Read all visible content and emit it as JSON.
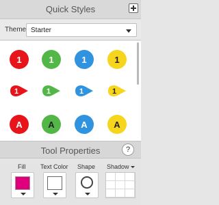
{
  "quick_styles": {
    "title": "Quick Styles",
    "add_icon": "plus-icon",
    "theme_label": "Theme:",
    "theme_value": "Starter",
    "colors": {
      "red": "#e8141c",
      "green": "#53b748",
      "blue": "#2f93e0",
      "yellow": "#f7d51d"
    },
    "rows": [
      {
        "kind": "circle-number",
        "items": [
          {
            "label": "1",
            "color": "red",
            "text_color": "#ffffff"
          },
          {
            "label": "1",
            "color": "green",
            "text_color": "#ffffff"
          },
          {
            "label": "1",
            "color": "blue",
            "text_color": "#ffffff"
          },
          {
            "label": "1",
            "color": "yellow",
            "text_color": "#222222"
          }
        ]
      },
      {
        "kind": "pointer-number",
        "items": [
          {
            "label": "1",
            "color": "red",
            "text_color": "#ffffff"
          },
          {
            "label": "1",
            "color": "green",
            "text_color": "#ffffff"
          },
          {
            "label": "1",
            "color": "blue",
            "text_color": "#ffffff"
          },
          {
            "label": "1",
            "color": "yellow",
            "text_color": "#222222"
          }
        ]
      },
      {
        "kind": "circle-letter",
        "items": [
          {
            "label": "A",
            "color": "red",
            "text_color": "#ffffff"
          },
          {
            "label": "A",
            "color": "green",
            "text_color": "#222222"
          },
          {
            "label": "A",
            "color": "blue",
            "text_color": "#ffffff"
          },
          {
            "label": "A",
            "color": "yellow",
            "text_color": "#222222"
          }
        ]
      }
    ]
  },
  "tool_properties": {
    "title": "Tool Properties",
    "help_label": "?",
    "fill_label": "Fill",
    "fill_color": "#e0007d",
    "text_color_label": "Text Color",
    "text_color_value": "#ffffff",
    "shape_label": "Shape",
    "shape_icon": "circle-outline-icon",
    "shadow_label": "Shadow"
  }
}
